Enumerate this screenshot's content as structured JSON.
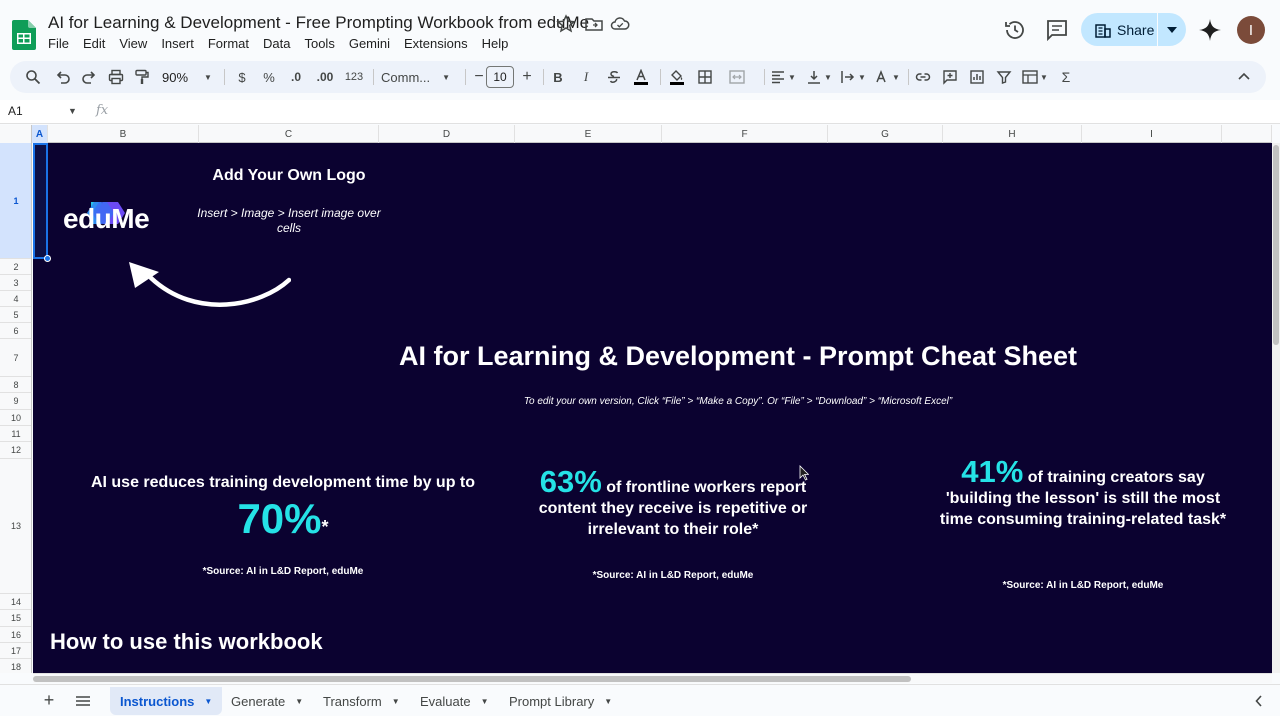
{
  "app": {
    "title": "AI for Learning & Development - Free Prompting Workbook from eduMe",
    "avatar_letter": "I"
  },
  "menu": [
    "File",
    "Edit",
    "View",
    "Insert",
    "Format",
    "Data",
    "Tools",
    "Gemini",
    "Extensions",
    "Help"
  ],
  "share": {
    "label": "Share"
  },
  "toolbar": {
    "zoom": "90%",
    "currency": "$",
    "percent": "%",
    "decrease_decimal": ".0",
    "increase_decimal": ".00",
    "number_format": "123",
    "font": "Comm...",
    "font_size": "10",
    "minus": "−",
    "plus": "+",
    "bold": "B",
    "italic": "I",
    "sum": "Σ"
  },
  "formula_bar": {
    "cell_ref": "A1",
    "fx": "fx"
  },
  "columns": [
    "A",
    "B",
    "C",
    "D",
    "E",
    "F",
    "G",
    "H",
    "I"
  ],
  "rows": [
    "1",
    "2",
    "3",
    "4",
    "5",
    "6",
    "7",
    "8",
    "9",
    "10",
    "11",
    "12",
    "13",
    "14",
    "15",
    "16",
    "17",
    "18"
  ],
  "sheet": {
    "brand_wordmark": "eduMe",
    "logo_heading": "Add Your Own Logo",
    "logo_instructions": "Insert > Image > Insert image over cells",
    "main_title": "AI for Learning & Development - Prompt Cheat Sheet",
    "edit_note": "To edit your own version, Click “File” > “Make a Copy”. Or “File” > “Download” > “Microsoft Excel”",
    "stat1": {
      "text": "AI use reduces training development time by up to",
      "number": "70%",
      "star": "*",
      "source": "*Source: AI in L&D Report, eduMe"
    },
    "stat2": {
      "number": "63%",
      "text": " of frontline workers report content they receive is repetitive or irrelevant to their role*",
      "source": "*Source: AI in L&D Report, eduMe"
    },
    "stat3": {
      "number": "41%",
      "text": " of training creators say 'building the lesson' is still the most time consuming training-related task*",
      "source": "*Source: AI in L&D Report, eduMe"
    },
    "howto_heading": "How to use this workbook"
  },
  "tabs": [
    {
      "label": "Instructions",
      "active": true
    },
    {
      "label": "Generate",
      "active": false
    },
    {
      "label": "Transform",
      "active": false
    },
    {
      "label": "Evaluate",
      "active": false
    },
    {
      "label": "Prompt Library",
      "active": false
    }
  ],
  "colors": {
    "sheet_bg": "#0b0230",
    "accent_cyan": "#25e2e6",
    "share_bg": "#c2e7ff",
    "selection": "#1a73e8"
  }
}
